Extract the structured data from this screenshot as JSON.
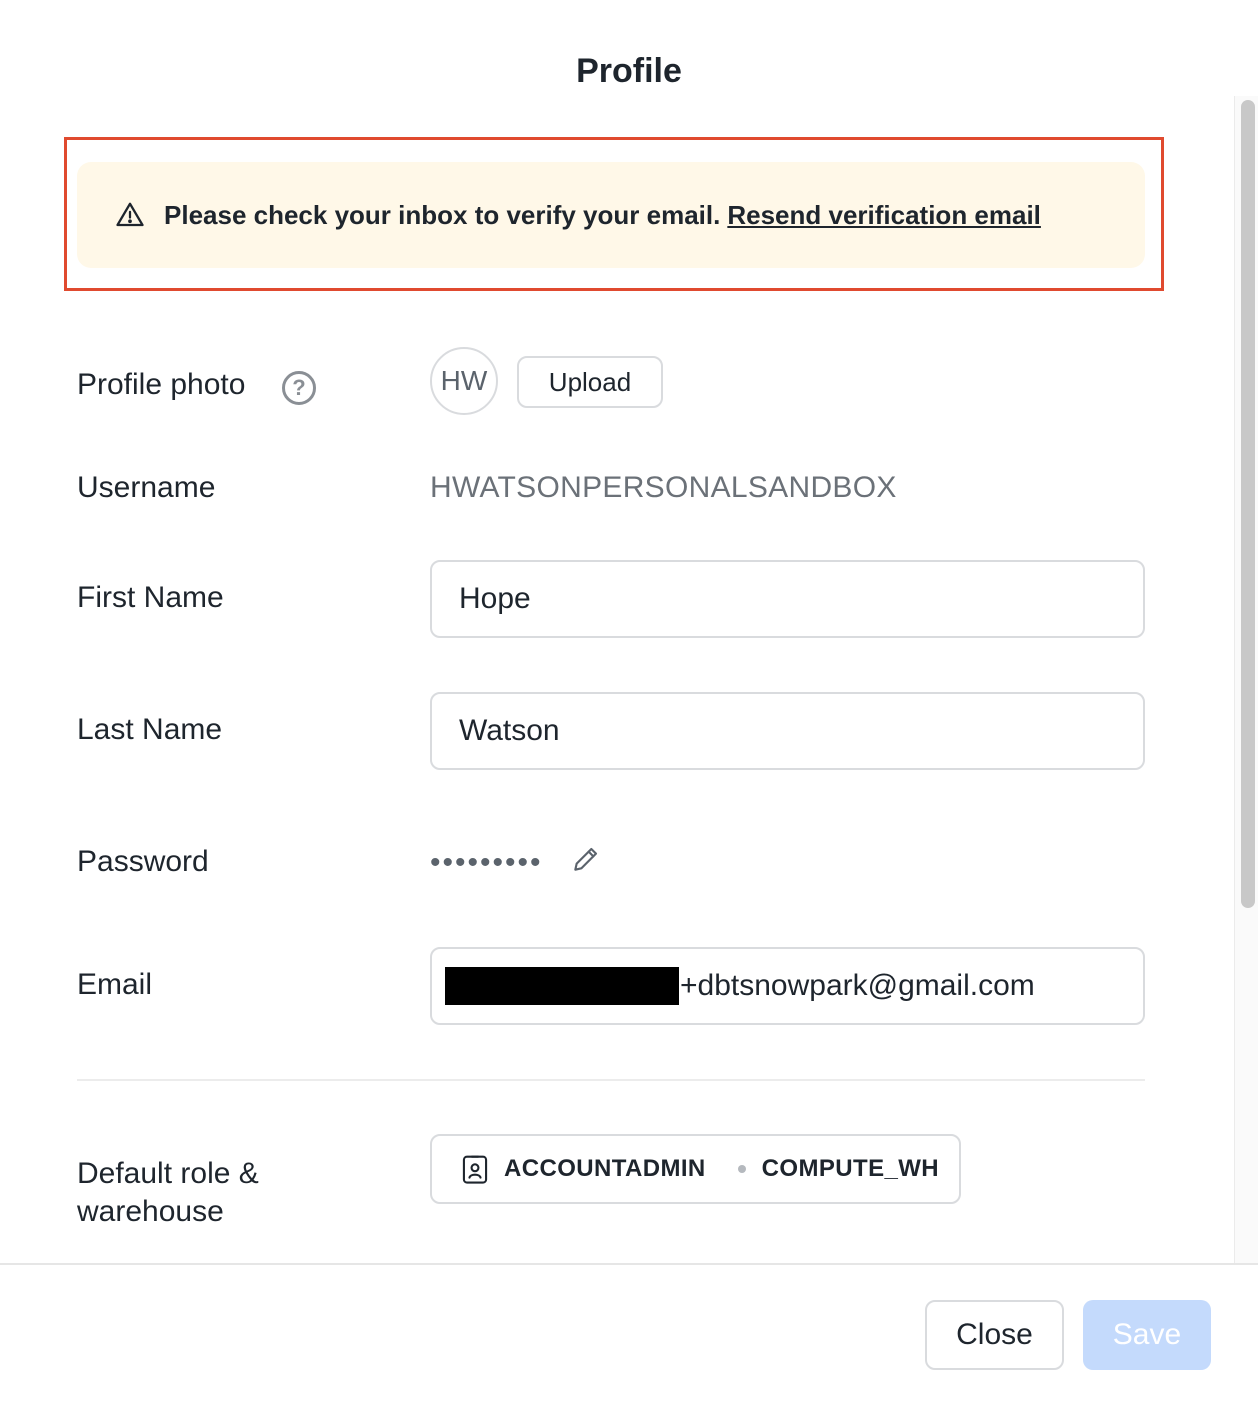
{
  "dialog": {
    "title": "Profile"
  },
  "banner": {
    "message": "Please check your inbox to verify your email.",
    "link": "Resend verification email",
    "icon": "warning-triangle-icon"
  },
  "profile_photo": {
    "label": "Profile photo",
    "help": "?",
    "initials": "HW",
    "upload_label": "Upload"
  },
  "username": {
    "label": "Username",
    "value": "HWATSONPERSONALSANDBOX"
  },
  "first_name": {
    "label": "First Name",
    "value": "Hope"
  },
  "last_name": {
    "label": "Last Name",
    "value": "Watson"
  },
  "password": {
    "label": "Password",
    "masked": "•••••••••",
    "edit_icon": "pencil-icon"
  },
  "email": {
    "label": "Email",
    "visible_suffix": "+dbtsnowpark@gmail.com"
  },
  "default_role": {
    "label_line1": "Default role &",
    "label_line2": "warehouse",
    "role": "ACCOUNTADMIN",
    "warehouse": "COMPUTE_WH",
    "icon": "id-badge-icon"
  },
  "footer": {
    "close_label": "Close",
    "save_label": "Save"
  },
  "colors": {
    "highlight": "#e04a2f",
    "banner_bg": "#fff8e8",
    "save_disabled": "#c4dafc",
    "text": "#1e252d",
    "muted": "#6b7178"
  }
}
